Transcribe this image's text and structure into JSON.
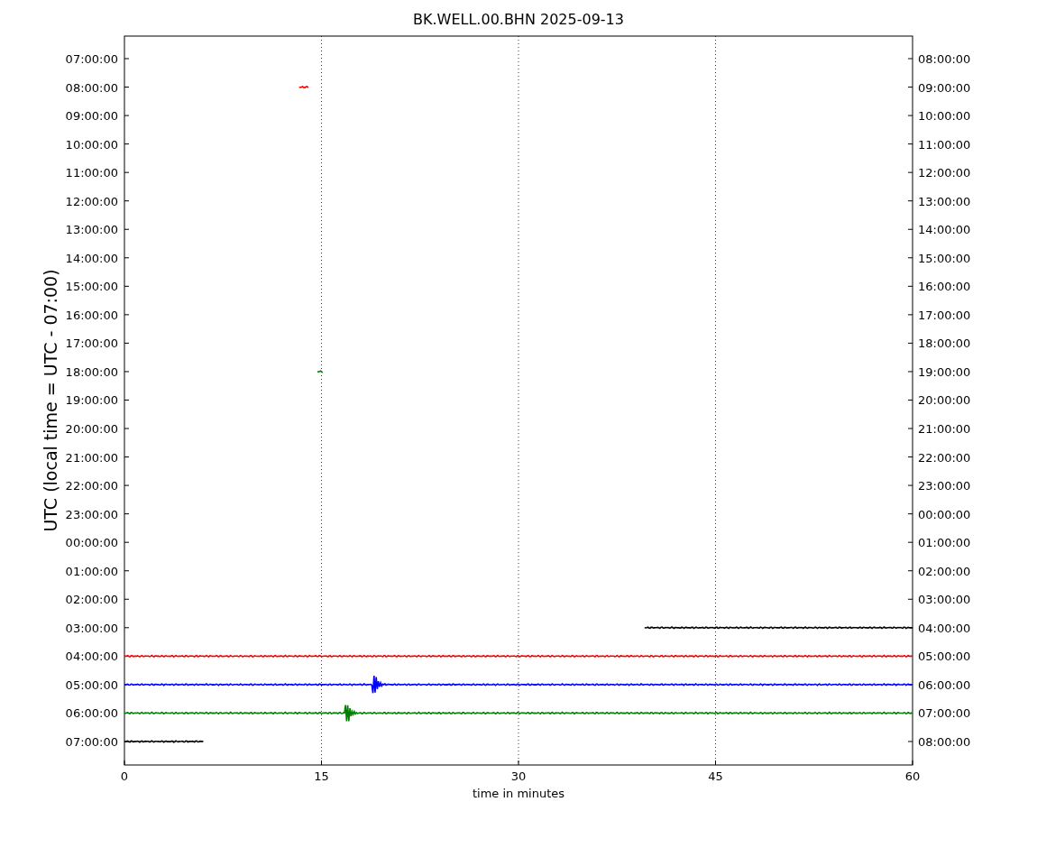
{
  "title": "BK.WELL.00.BHN 2025-09-13",
  "plot": {
    "xlabel": "time in minutes",
    "ylabel": "UTC (local time = UTC - 07:00)",
    "x_tick_labels": [
      "0",
      "15",
      "30",
      "45",
      "60"
    ],
    "left_tick_labels": [
      "07:00:00",
      "08:00:00",
      "09:00:00",
      "10:00:00",
      "11:00:00",
      "12:00:00",
      "13:00:00",
      "14:00:00",
      "15:00:00",
      "16:00:00",
      "17:00:00",
      "18:00:00",
      "19:00:00",
      "20:00:00",
      "21:00:00",
      "22:00:00",
      "23:00:00",
      "00:00:00",
      "01:00:00",
      "02:00:00",
      "03:00:00",
      "04:00:00",
      "05:00:00",
      "06:00:00",
      "07:00:00"
    ],
    "right_tick_labels": [
      "08:00:00",
      "09:00:00",
      "10:00:00",
      "11:00:00",
      "12:00:00",
      "13:00:00",
      "14:00:00",
      "15:00:00",
      "16:00:00",
      "17:00:00",
      "18:00:00",
      "19:00:00",
      "20:00:00",
      "21:00:00",
      "22:00:00",
      "23:00:00",
      "00:00:00",
      "01:00:00",
      "02:00:00",
      "03:00:00",
      "04:00:00",
      "05:00:00",
      "06:00:00",
      "07:00:00",
      "08:00:00"
    ]
  }
}
